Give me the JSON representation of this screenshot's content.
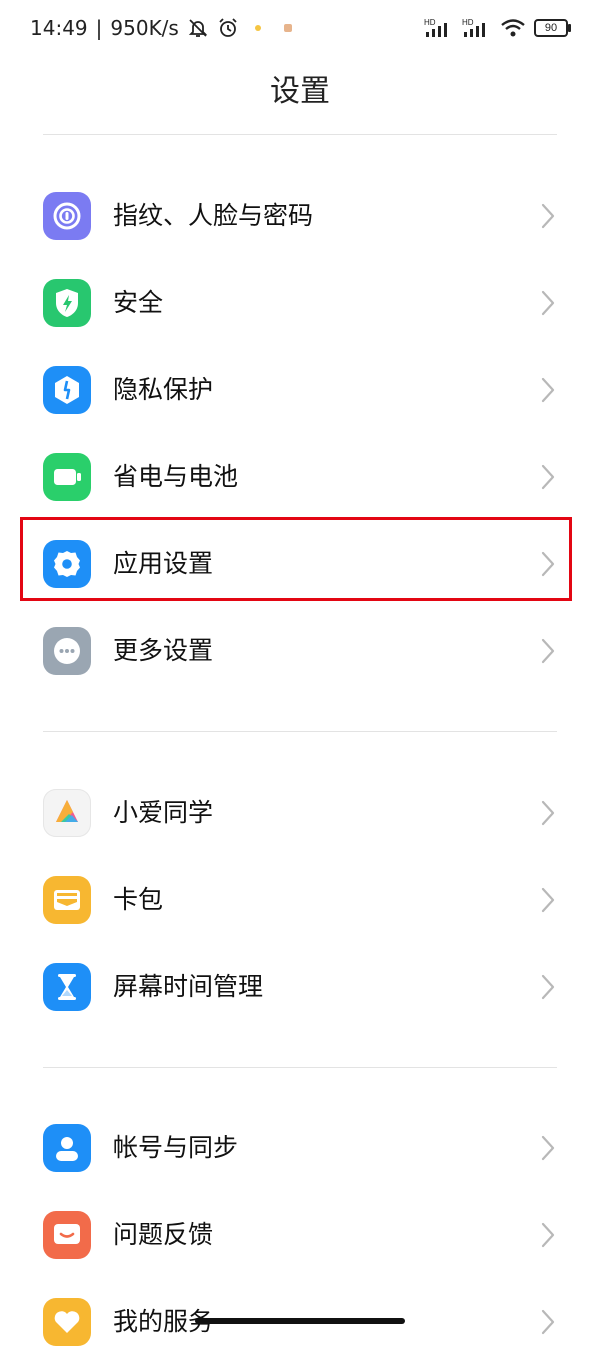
{
  "status_bar": {
    "time": "14:49",
    "separator": "|",
    "speed": "950K/s",
    "battery": "90",
    "signal_1_label": "HD",
    "signal_2_label": "HD"
  },
  "header": {
    "title": "设置"
  },
  "groups": [
    {
      "items": [
        {
          "label": "指纹、人脸与密码",
          "icon": "fingerprint-icon",
          "color": "#7B7BF2"
        },
        {
          "label": "安全",
          "icon": "shield-bolt-icon",
          "color": "#28C76F"
        },
        {
          "label": "隐私保护",
          "icon": "privacy-icon",
          "color": "#1E8FF7"
        },
        {
          "label": "省电与电池",
          "icon": "battery-icon",
          "color": "#2ACF6B"
        },
        {
          "label": "应用设置",
          "icon": "gear-icon",
          "color": "#1E8FF7",
          "highlighted": true
        },
        {
          "label": "更多设置",
          "icon": "more-dots-icon",
          "color": "#9AA6B2"
        }
      ]
    },
    {
      "items": [
        {
          "label": "小爱同学",
          "icon": "xiaoai-icon",
          "color": "#F4F4F4"
        },
        {
          "label": "卡包",
          "icon": "wallet-icon",
          "color": "#F7B731"
        },
        {
          "label": "屏幕时间管理",
          "icon": "hourglass-icon",
          "color": "#1E8FF7"
        }
      ]
    },
    {
      "items": [
        {
          "label": "帐号与同步",
          "icon": "account-icon",
          "color": "#1E8FF7"
        },
        {
          "label": "问题反馈",
          "icon": "feedback-icon",
          "color": "#F26B4A"
        },
        {
          "label": "我的服务",
          "icon": "heart-service-icon",
          "color": "#F7B731"
        }
      ]
    }
  ],
  "colors": {
    "highlight_border": "#e30613",
    "chevron": "#b8b8b8",
    "divider": "#e3e3e3"
  }
}
